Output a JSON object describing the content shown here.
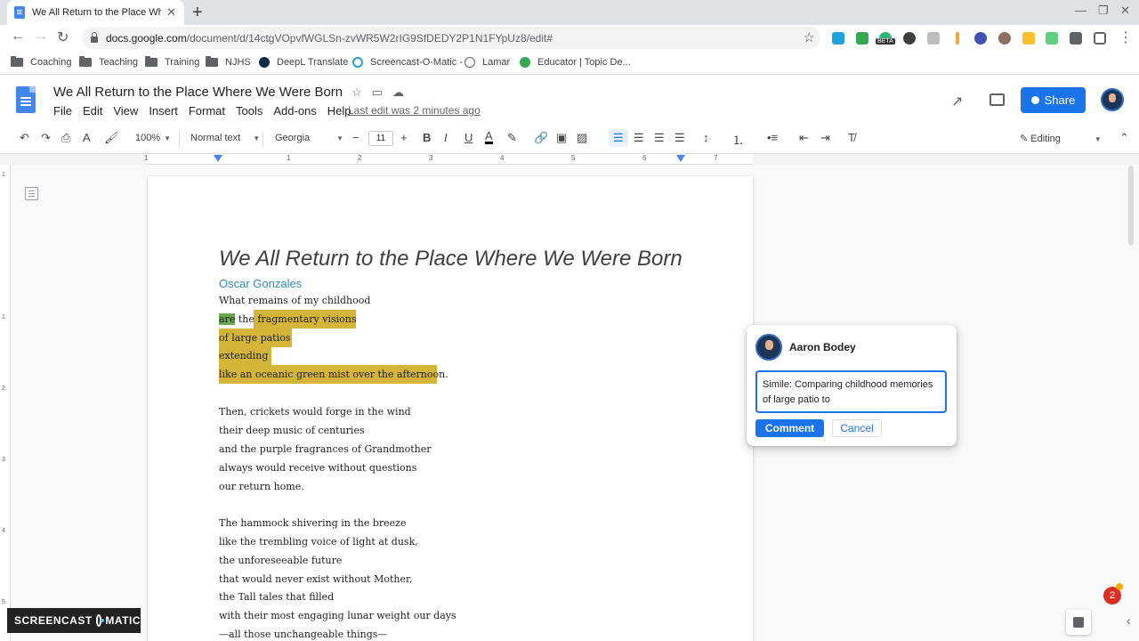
{
  "browser": {
    "tab_title": "We All Return to the Place Where",
    "url_host": "docs.google.com",
    "url_path": "/document/d/14ctgVOpvfWGLSn-zvWR5W2rIG9SfDEDY2P1N1FYpUz8/edit#",
    "beta_badge": "BETA"
  },
  "bookmarks": [
    {
      "label": "Coaching",
      "icon": "folder-icon"
    },
    {
      "label": "Teaching",
      "icon": "folder-icon"
    },
    {
      "label": "Training",
      "icon": "folder-icon"
    },
    {
      "label": "NJHS",
      "icon": "folder-icon"
    },
    {
      "label": "DeepL Translate",
      "icon": "deepl-icon"
    },
    {
      "label": "Screencast-O-Matic -",
      "icon": "screencast-icon"
    },
    {
      "label": "Lamar",
      "icon": "globe-icon"
    },
    {
      "label": "Educator | Topic De...",
      "icon": "educator-icon"
    }
  ],
  "docs": {
    "title": "We All Return to the Place Where We Were Born",
    "menu": [
      "File",
      "Edit",
      "View",
      "Insert",
      "Format",
      "Tools",
      "Add-ons",
      "Help"
    ],
    "last_edit": "Last edit was 2 minutes ago",
    "share_label": "Share"
  },
  "toolbar": {
    "zoom": "100%",
    "style": "Normal text",
    "font": "Georgia",
    "font_size": "11",
    "mode": "Editing"
  },
  "ruler": [
    "1",
    "1",
    "2",
    "3",
    "4",
    "5",
    "6",
    "7"
  ],
  "vruler": [
    "1",
    "1",
    "2",
    "3",
    "4",
    "5"
  ],
  "poem": {
    "title": "We All Return to the Place Where We Were Born",
    "author": "Oscar Gonzales",
    "line1": "What remains of my childhood",
    "line2_green": "are",
    "line2_plain": " the ",
    "line2_hl": "fragmentary visions",
    "line3": "of large patios",
    "line4": "extending",
    "line5": "like an oceanic green mist over the afternoon.",
    "stanza2": [
      "Then, crickets would forge in the wind",
      "their deep music of centuries",
      "and the purple fragrances of Grandmother",
      "always would receive without questions",
      "our return home."
    ],
    "stanza3": [
      "The hammock shivering in the breeze",
      "like the trembling voice of light at dusk,",
      "the unforeseeable future",
      "that would never exist without Mother,",
      "the Tall tales that filled",
      "with their most engaging lunar weight our days",
      "—all those unchangeable things—"
    ]
  },
  "comment": {
    "author": "Aaron Bodey",
    "text": "Simile: Comparing childhood memories of large patio to",
    "comment_label": "Comment",
    "cancel_label": "Cancel"
  },
  "overlay": {
    "screencast_left": "SCREENCAST",
    "screencast_right": "MATIC",
    "notification_count": "2"
  },
  "colors": {
    "highlight_yellow": "#d4b53a",
    "highlight_green": "#6aa84f",
    "accent": "#1a73e8",
    "author": "#2e8bbf"
  }
}
